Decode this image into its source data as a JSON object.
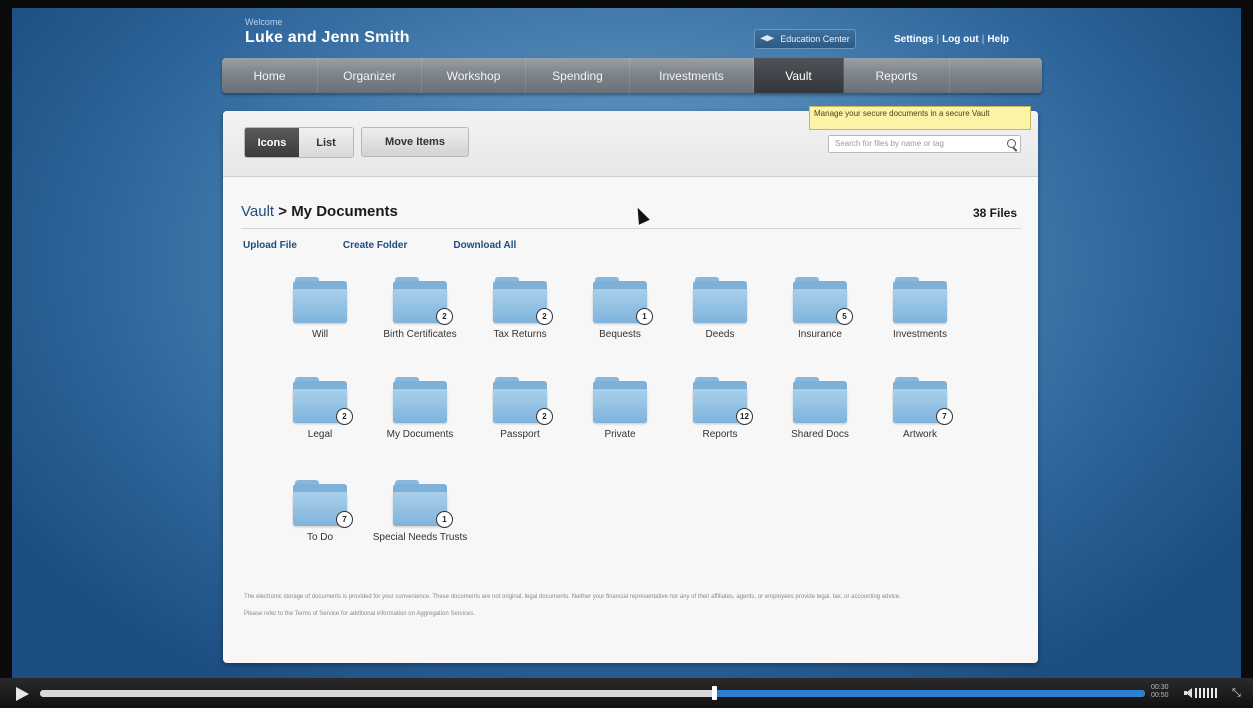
{
  "header": {
    "welcome_label": "Welcome",
    "user_name": "Luke and Jenn Smith",
    "education_center_label": "Education Center",
    "settings_label": "Settings",
    "logout_label": "Log out",
    "help_label": "Help",
    "separator": "|"
  },
  "nav": {
    "items": [
      {
        "label": "Home",
        "active": false
      },
      {
        "label": "Organizer",
        "active": false
      },
      {
        "label": "Workshop",
        "active": false
      },
      {
        "label": "Spending",
        "active": false
      },
      {
        "label": "Investments",
        "active": false
      },
      {
        "label": "Vault",
        "active": true
      },
      {
        "label": "Reports",
        "active": false
      }
    ],
    "tooltip": "Manage your secure documents in a secure Vault"
  },
  "toolbar": {
    "icons_label": "Icons",
    "list_label": "List",
    "move_items_label": "Move Items",
    "search_placeholder": "Search for files by name or tag"
  },
  "breadcrumb": {
    "root": "Vault",
    "separator": ">",
    "current": "My Documents"
  },
  "file_count": "38 Files",
  "actions": {
    "upload": "Upload File",
    "create_folder": "Create Folder",
    "download_all": "Download All"
  },
  "folders": [
    {
      "name": "Will",
      "count": ""
    },
    {
      "name": "Birth Certificates",
      "count": "2"
    },
    {
      "name": "Tax Returns",
      "count": "2"
    },
    {
      "name": "Bequests",
      "count": "1"
    },
    {
      "name": "Deeds",
      "count": ""
    },
    {
      "name": "Insurance",
      "count": "5"
    },
    {
      "name": "Investments",
      "count": ""
    },
    {
      "name": "Legal",
      "count": "2"
    },
    {
      "name": "My Documents",
      "count": ""
    },
    {
      "name": "Passport",
      "count": "2"
    },
    {
      "name": "Private",
      "count": ""
    },
    {
      "name": "Reports",
      "count": "12"
    },
    {
      "name": "Shared Docs",
      "count": ""
    },
    {
      "name": "Artwork",
      "count": "7"
    },
    {
      "name": "To Do",
      "count": "7"
    },
    {
      "name": "Special Needs Trusts",
      "count": "1"
    }
  ],
  "disclaimer": {
    "line1": "The electronic storage of documents is provided for your convenience. These documents are not original, legal documents. Neither your financial representative nor any of their affiliates, agents, or employees provide legal, tax, or accounting advice.",
    "line2": "Please refer to the Terms of Service for additional information on Aggregation Services."
  },
  "player": {
    "elapsed": "00:30",
    "duration": "00:50",
    "progress_fraction": 0.61,
    "icons": [
      "play-icon",
      "volume-icon",
      "fullscreen-icon"
    ]
  }
}
